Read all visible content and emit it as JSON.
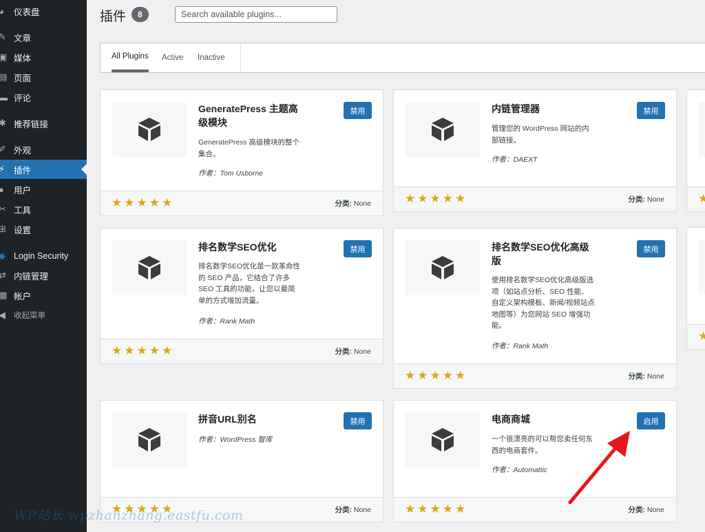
{
  "sidebar": {
    "items": [
      {
        "label": "仪表盘",
        "icon": "dashboard-icon"
      },
      {
        "label": "文章",
        "icon": "pin-icon"
      },
      {
        "label": "媒体",
        "icon": "media-icon"
      },
      {
        "label": "页面",
        "icon": "page-icon"
      },
      {
        "label": "评论",
        "icon": "comment-icon"
      },
      {
        "label": "推荐链接",
        "icon": "link-icon"
      },
      {
        "label": "外观",
        "icon": "brush-icon"
      },
      {
        "label": "插件",
        "icon": "plugin-icon"
      },
      {
        "label": "用户",
        "icon": "user-icon"
      },
      {
        "label": "工具",
        "icon": "wrench-icon"
      },
      {
        "label": "设置",
        "icon": "settings-icon"
      },
      {
        "label": "Login Security",
        "icon": "shield-icon"
      },
      {
        "label": "内链管理",
        "icon": "link-manager-icon"
      },
      {
        "label": "帐户",
        "icon": "account-icon"
      },
      {
        "label": "收起菜单",
        "icon": "collapse-icon"
      }
    ],
    "active_label": "插件"
  },
  "header": {
    "title": "插件",
    "count": "8",
    "search_placeholder": "Search available plugins..."
  },
  "filters": {
    "all": "All Plugins",
    "active": "Active",
    "inactive": "Inactive"
  },
  "plugins": [
    {
      "name": "GeneratePress 主题高级模块",
      "desc": "GeneratePress 高级模块的整个集合。",
      "author": "作者：Tom Usborne",
      "button": "禁用",
      "category_label": "分类:",
      "category": "None",
      "rating": 5
    },
    {
      "name": "内链管理器",
      "desc": "管理您的 WordPress 网站的内部链接。",
      "author": "作者：DAEXT",
      "button": "禁用",
      "category_label": "分类:",
      "category": "None",
      "rating": 5
    },
    {
      "name": "排名数学SEO优化",
      "desc": "排名数学SEO优化是一款革命性的 SEO 产品，它结合了许多 SEO 工具的功能，让您以最简单的方式增加流量。",
      "author": "作者：Rank Math",
      "button": "禁用",
      "category_label": "分类:",
      "category": "None",
      "rating": 5
    },
    {
      "name": "排名数学SEO优化高级版",
      "desc": "使用排名数学SEO优化高级版选项（如站点分析、SEO 性能、自定义架构模板、新闻/视频站点地图等）为您网站 SEO 增强功能。",
      "author": "作者：Rank Math",
      "button": "禁用",
      "category_label": "分类:",
      "category": "None",
      "rating": 5
    },
    {
      "name": "拼音URL别名",
      "desc": "",
      "author": "作者：WordPress 智库",
      "button": "禁用",
      "category_label": "分类:",
      "category": "None",
      "rating": 5
    },
    {
      "name": "电商商城",
      "desc": "一个很漂亮的可以帮您卖任何东西的电商套件。",
      "author": "作者：Automattic",
      "button": "启用",
      "category_label": "分类:",
      "category": "None",
      "rating": 5
    }
  ],
  "watermark": "WP站长 wpzhanzhang.eastfu.com",
  "colors": {
    "sidebar": "#1d2327",
    "accent": "#2271b1",
    "star": "#dba617",
    "arrow": "#e8161b"
  }
}
